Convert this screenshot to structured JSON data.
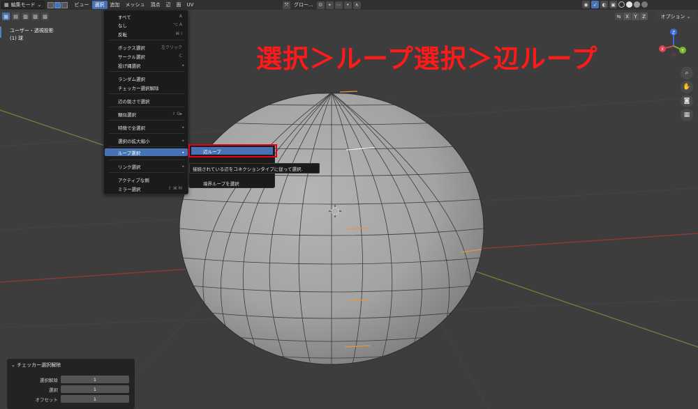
{
  "header": {
    "mode_label": "編集モード",
    "menus": [
      "ビュー",
      "選択",
      "追加",
      "メッシュ",
      "頂点",
      "辺",
      "面",
      "UV"
    ],
    "active_menu_index": 1,
    "transform_orientation": "グロー..."
  },
  "subbar": {
    "axes": [
      "X",
      "Y",
      "Z"
    ],
    "options_label": "オプション"
  },
  "viewport": {
    "view_name": "ユーザー・透視投影",
    "object_name": "(1) 球"
  },
  "annotation": "選択＞ループ選択＞辺ループ",
  "gizmo": {
    "x_label": "X",
    "y_label": "Y",
    "z_label": "Z"
  },
  "select_menu": {
    "items": [
      {
        "label": "すべて",
        "shortcut": "A"
      },
      {
        "label": "なし",
        "shortcut": "⌥ A"
      },
      {
        "label": "反転",
        "shortcut": "⌘ I"
      },
      {
        "label": "ボックス選択",
        "shortcut": "左クリック"
      },
      {
        "label": "サークル選択",
        "shortcut": "C"
      },
      {
        "label": "投げ縄選択",
        "shortcut": "▸"
      },
      {
        "label": "ランダム選択",
        "shortcut": ""
      },
      {
        "label": "チェッカー選択解除",
        "shortcut": ""
      },
      {
        "label": "辺の鋭さで選択",
        "shortcut": ""
      },
      {
        "label": "類似選択",
        "shortcut": "⇧ G▸"
      },
      {
        "label": "特徴で全選択",
        "shortcut": "▸"
      },
      {
        "label": "選択の拡大縮小",
        "shortcut": "▸"
      },
      {
        "label": "ループ選択",
        "shortcut": "▸"
      },
      {
        "label": "リンク選択",
        "shortcut": "▸"
      },
      {
        "label": "アクティブな側",
        "shortcut": ""
      },
      {
        "label": "ミラー選択",
        "shortcut": "⇧ ⌘ M"
      }
    ]
  },
  "loop_submenu": {
    "highlighted": "辺ループ",
    "tooltip": "接続されている辺をコネクションタイプに従って選択.",
    "other_item": "境界ループを選択"
  },
  "operator_panel": {
    "title": "チェッカー選択解除",
    "fields": [
      {
        "label": "選択解除",
        "value": "1"
      },
      {
        "label": "選択",
        "value": "1"
      },
      {
        "label": "オフセット",
        "value": "1"
      }
    ]
  },
  "colors": {
    "accent": "#4772b3",
    "annotation": "#ff1a1a",
    "selected_edge": "#e8953a",
    "background": "#3d3d3d"
  }
}
